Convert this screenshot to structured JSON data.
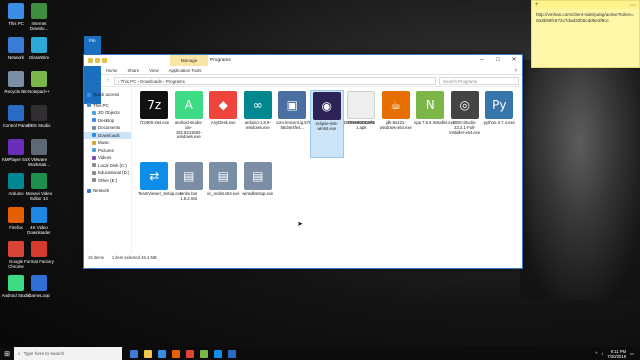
{
  "desktop": {
    "icons": [
      {
        "label": "This PC",
        "icon": "computer-icon",
        "color": "#3a8ee6"
      },
      {
        "label": "Internet Downlo...",
        "icon": "idm-icon",
        "color": "#3f8e3f"
      },
      {
        "label": "Network",
        "icon": "network-icon",
        "color": "#3a7bd5"
      },
      {
        "label": "GlassWire",
        "icon": "glasswire-icon",
        "color": "#2ea8d6"
      },
      {
        "label": "Recycle Bin",
        "icon": "recycle-bin-icon",
        "color": "#7a8fa6"
      },
      {
        "label": "Notepad++",
        "icon": "notepadpp-icon",
        "color": "#7ab648"
      },
      {
        "label": "Control Panel",
        "icon": "control-panel-icon",
        "color": "#2b6cc4"
      },
      {
        "label": "OBS Studio",
        "icon": "obs-icon",
        "color": "#302e31"
      },
      {
        "label": "KMPlayer 64X",
        "icon": "kmplayer-icon",
        "color": "#6a2fb8"
      },
      {
        "label": "VMware Workstati...",
        "icon": "vmware-icon",
        "color": "#5d6a76"
      },
      {
        "label": "Arduino",
        "icon": "arduino-icon",
        "color": "#00878f"
      },
      {
        "label": "Movavi Video Editor 14",
        "icon": "movavi-icon",
        "color": "#1d8f4e"
      },
      {
        "label": "Firefox",
        "icon": "firefox-icon",
        "color": "#e66000"
      },
      {
        "label": "4K Video Downloader",
        "icon": "4k-downloader-icon",
        "color": "#1e88e5"
      },
      {
        "label": "Google Chrome",
        "icon": "chrome-icon",
        "color": "#db4437"
      },
      {
        "label": "Format Factory",
        "icon": "format-factory-icon",
        "color": "#d63b2f"
      },
      {
        "label": "Android Studio",
        "icon": "android-studio-icon",
        "color": "#3ddc84"
      },
      {
        "label": "GameLoop",
        "icon": "gameloop-icon",
        "color": "#2f6fd6"
      }
    ]
  },
  "sticky_note": {
    "add": "+",
    "menu": "⋯",
    "text": "http://vmhas.com/client-side/pubg/active?token=0a3b59fc572c7dad32b5cdd5e2f9cc"
  },
  "explorer": {
    "manage_tab": "Manage",
    "title": "Programs",
    "ribbon_tabs": [
      "File",
      "Home",
      "Share",
      "View",
      "Application Tools"
    ],
    "address": {
      "back": "←",
      "forward": "→",
      "up": "↑",
      "path": "› This PC › Downloads › Programs",
      "search_placeholder": "Search Programs"
    },
    "sidebar": [
      {
        "label": "Quick access",
        "color": "#3a8ee6"
      },
      {
        "label": "This PC",
        "color": "#3a8ee6"
      },
      {
        "label": "3D Objects",
        "color": "#4aa3df"
      },
      {
        "label": "Desktop",
        "color": "#3a8ee6"
      },
      {
        "label": "Documents",
        "color": "#7a8fa6"
      },
      {
        "label": "Downloads",
        "color": "#2b8ae6"
      },
      {
        "label": "Music",
        "color": "#d8a33b"
      },
      {
        "label": "Pictures",
        "color": "#4aa3df"
      },
      {
        "label": "Videos",
        "color": "#7a4fb8"
      },
      {
        "label": "Local Disk (C:)",
        "color": "#8a8a8a"
      },
      {
        "label": "Educational (D:)",
        "color": "#8a8a8a"
      },
      {
        "label": "Other (E:)",
        "color": "#8a8a8a"
      },
      {
        "label": "Network",
        "color": "#3a7bd5"
      }
    ],
    "files": [
      {
        "label": "7z1900-x64.exe",
        "icon": "7zip-icon",
        "color": "#111111",
        "glyph": "7z"
      },
      {
        "label": "android-studio-ide-192.6241682-windows.exe",
        "icon": "android-studio-icon",
        "color": "#3ddc84",
        "glyph": "A"
      },
      {
        "label": "AnyDesk.exe",
        "icon": "anydesk-icon",
        "color": "#ef443b",
        "glyph": "◆"
      },
      {
        "label": "arduino-1.8.9-windows.exe",
        "icon": "arduino-icon",
        "color": "#00878f",
        "glyph": "∞"
      },
      {
        "label": "com.tencent.ig.57091f3d5a8f0b4f4232869e6926a9f6 56d4e4fe4...",
        "icon": "pubg-icon",
        "color": "#4a6fa0",
        "glyph": "▣"
      },
      {
        "label": "eclipse-inst-win64.exe",
        "icon": "eclipse-icon",
        "color": "#2c2255",
        "glyph": "◉"
      },
      {
        "label": "F0364D0C0A4 1.apk",
        "icon": "apk-file-icon",
        "color": "#eeeeee",
        "glyph": ""
      },
      {
        "label": "jdk-8u221-windows-x64.exe",
        "icon": "java-icon",
        "color": "#e76f00",
        "glyph": "☕"
      },
      {
        "label": "npp.7.6.6.Installer.exe",
        "icon": "notepadpp-icon",
        "color": "#7ab648",
        "glyph": "N"
      },
      {
        "label": "OBS-Studio-23.2.1-Full-Installer-x64.exe",
        "icon": "obs-icon",
        "color": "#444444",
        "glyph": "◎"
      },
      {
        "label": "python-3.7.4.exe",
        "icon": "python-icon",
        "color": "#3776ab",
        "glyph": "Py"
      },
      {
        "label": "TeamViewer_Setup.exe",
        "icon": "teamviewer-icon",
        "color": "#0e8ee9",
        "glyph": "⇄"
      },
      {
        "label": "Unitu bar 1.8.2.msi",
        "icon": "msi-package-icon",
        "color": "#7a8fa6",
        "glyph": "▤"
      },
      {
        "label": "vc_redist.x64.exe",
        "icon": "installer-icon",
        "color": "#7a8fa6",
        "glyph": "▤"
      },
      {
        "label": "winsdksetup.exe",
        "icon": "installer-icon",
        "color": "#7a8fa6",
        "glyph": "▤"
      }
    ],
    "status": {
      "items": "15 items",
      "selected": "1 item selected  46.4 MB"
    }
  },
  "taskbar": {
    "start": "⊞",
    "search_placeholder": "Type here to search",
    "apps": [
      "#3a7bd5",
      "#f2c94c",
      "#3a8ee6",
      "#e66000",
      "#db4437",
      "#7ab648",
      "#0e8ee9",
      "#2b6cc4"
    ],
    "time": "9:11 PM",
    "date": "7/30/2019"
  }
}
